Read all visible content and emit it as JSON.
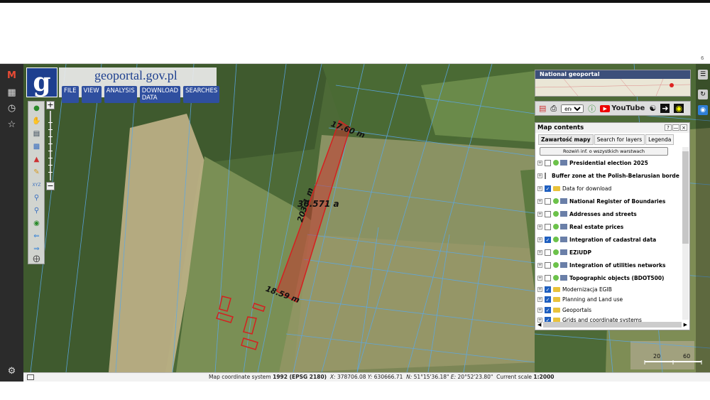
{
  "app": {
    "brand": "geoportal.gov.pl",
    "logo_letter": "g"
  },
  "menu": [
    "FILE",
    "VIEW",
    "ANALYSIS",
    "DOWNLOAD DATA",
    "SEARCHES"
  ],
  "overview": {
    "title": "National geoportal"
  },
  "toolbar": {
    "lang": "eng",
    "youtube": "YouTube"
  },
  "map_contents": {
    "title": "Map contents",
    "tabs": [
      "Zawartość mapy",
      "Search for layers",
      "Legenda"
    ],
    "expand_button": "Rozwiń inf. o wszystkich warstwach",
    "layers": [
      {
        "label": "Presidential election 2025",
        "checked": false,
        "bold": true
      },
      {
        "label": "Buffer zone at the Polish-Belarusian border",
        "checked": false,
        "bold": true
      },
      {
        "label": "Data for download",
        "checked": true,
        "bold": false
      },
      {
        "label": "National Register of Boundaries",
        "checked": false,
        "bold": true
      },
      {
        "label": "Addresses and streets",
        "checked": false,
        "bold": true
      },
      {
        "label": "Real estate prices",
        "checked": false,
        "bold": true
      },
      {
        "label": "Integration of cadastral data",
        "checked": true,
        "bold": true
      },
      {
        "label": "EZiUDP",
        "checked": false,
        "bold": true
      },
      {
        "label": "Integration of utilities networks",
        "checked": false,
        "bold": true
      },
      {
        "label": "Topographic objects (BDOT500)",
        "checked": false,
        "bold": true
      },
      {
        "label": "Modernizacja EGIB",
        "checked": true,
        "bold": false
      },
      {
        "label": "Planning and Land use",
        "checked": true,
        "bold": false
      },
      {
        "label": "Geoportals",
        "checked": true,
        "bold": false
      },
      {
        "label": "Grids and coordinate systems",
        "checked": true,
        "bold": false
      }
    ]
  },
  "map": {
    "dim_top": "17.60 m",
    "dim_side": "203.1 m",
    "dim_area": "36.571 a",
    "dim_bottom": "18.59 m",
    "scale_left": "20",
    "scale_right": "60"
  },
  "status": {
    "crs_label": "Map coordinate system",
    "crs": "1992 (EPSG 2180)",
    "x_label": "X:",
    "x": "378706.08",
    "y_label": "Y:",
    "y": "630666.71",
    "n_label": "N:",
    "n": "51°15'36.18\"",
    "e_label": "E:",
    "e": "20°52'23.80\"",
    "scale_label": "Current scale",
    "scale": "1:2000"
  },
  "colors": {
    "accent": "#1d3f8f",
    "parcel": "#d42020",
    "leftbar": "#2b2b2b"
  },
  "icons": [
    "gmail-icon",
    "save-icon",
    "history-icon",
    "star-icon",
    "settings-icon"
  ]
}
